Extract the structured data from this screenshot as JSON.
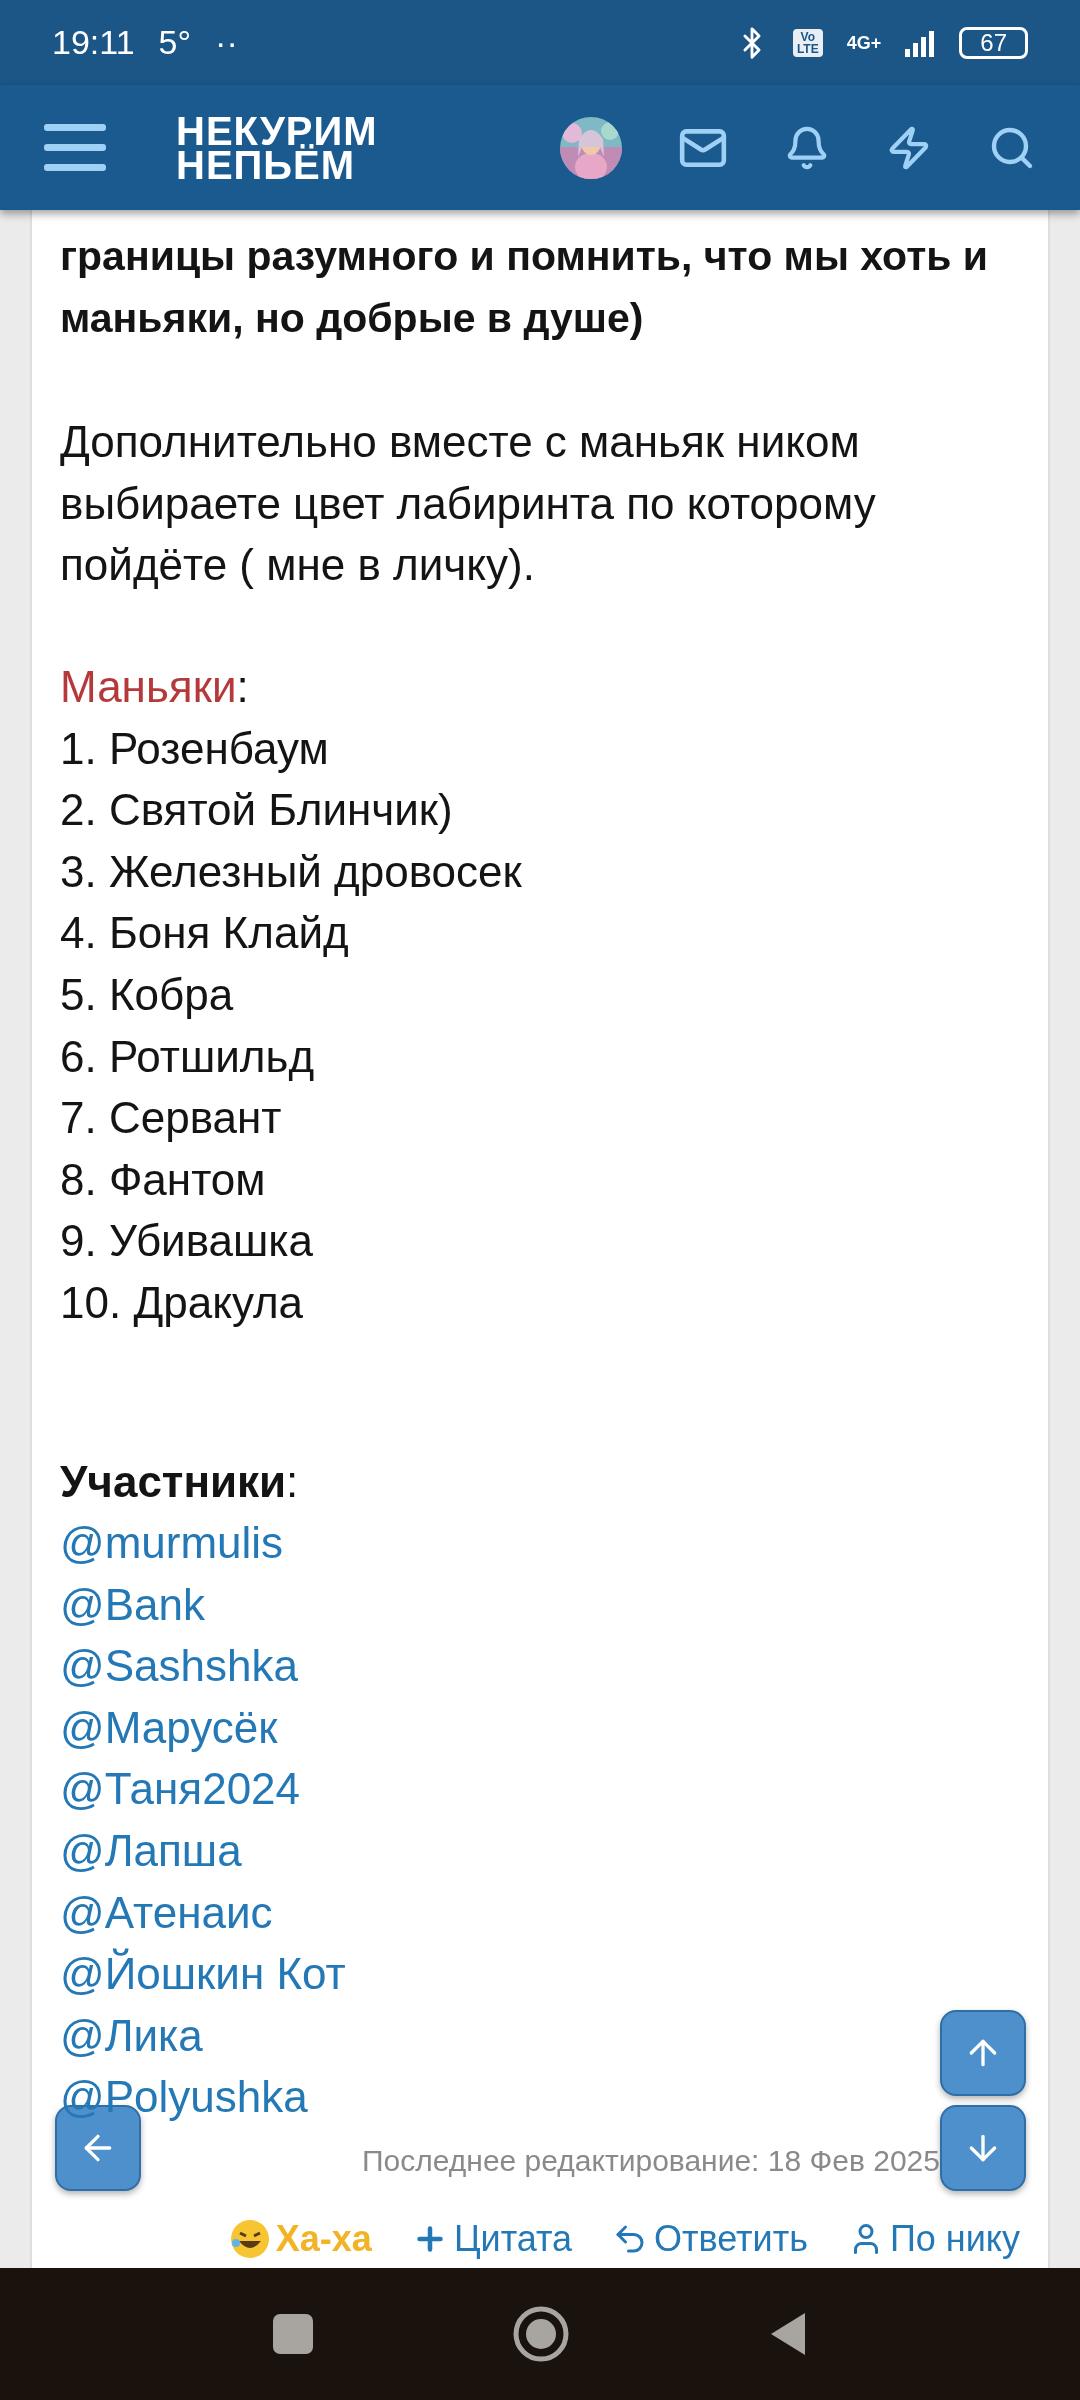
{
  "status_bar": {
    "time": "19:11",
    "temperature": "5°",
    "dots": "··",
    "volte": "Vo LTE",
    "network": "4G+",
    "battery": "67"
  },
  "header": {
    "logo_lines": [
      "НЕКУРИМ",
      "НЕПЬЁМ"
    ]
  },
  "post": {
    "intro": "границы разумного и помнить, что мы хоть и маньяки, но добрые в душе)",
    "note": "Дополнительно вместе с маньяк ником выбираете цвет лабиринта по которому пойдёте ( мне в личку).",
    "sections": [
      {
        "kind": "roles",
        "heading": "Маньяки",
        "suffix": ":",
        "items": [
          "1. Розенбаум",
          "2. Святой Блинчик)",
          "3. Железный дровосек",
          "4. Боня Клайд",
          "5. Кобра",
          "6. Ротшильд",
          "7. Сервант",
          "8. Фантом",
          "9. Убивашка",
          "10. Дракула"
        ]
      },
      {
        "kind": "mentions",
        "heading": "Участники",
        "suffix": ":",
        "items": [
          "@murmulis",
          "@Bank",
          "@Sashshka",
          "@Марусёк",
          "@Таня2024",
          "@Лапша",
          "@Атенаис",
          "@Йошкин Кот",
          "@Лика",
          "@Polyushka"
        ]
      }
    ],
    "edited": "Последнее редактирование: 18 Фев 2025",
    "actions": [
      {
        "kind": "reaction",
        "label": "Ха-ха"
      },
      {
        "kind": "quote",
        "label": "Цитата"
      },
      {
        "kind": "reply",
        "label": "Ответить"
      },
      {
        "kind": "author",
        "label": "По нику"
      }
    ]
  }
}
